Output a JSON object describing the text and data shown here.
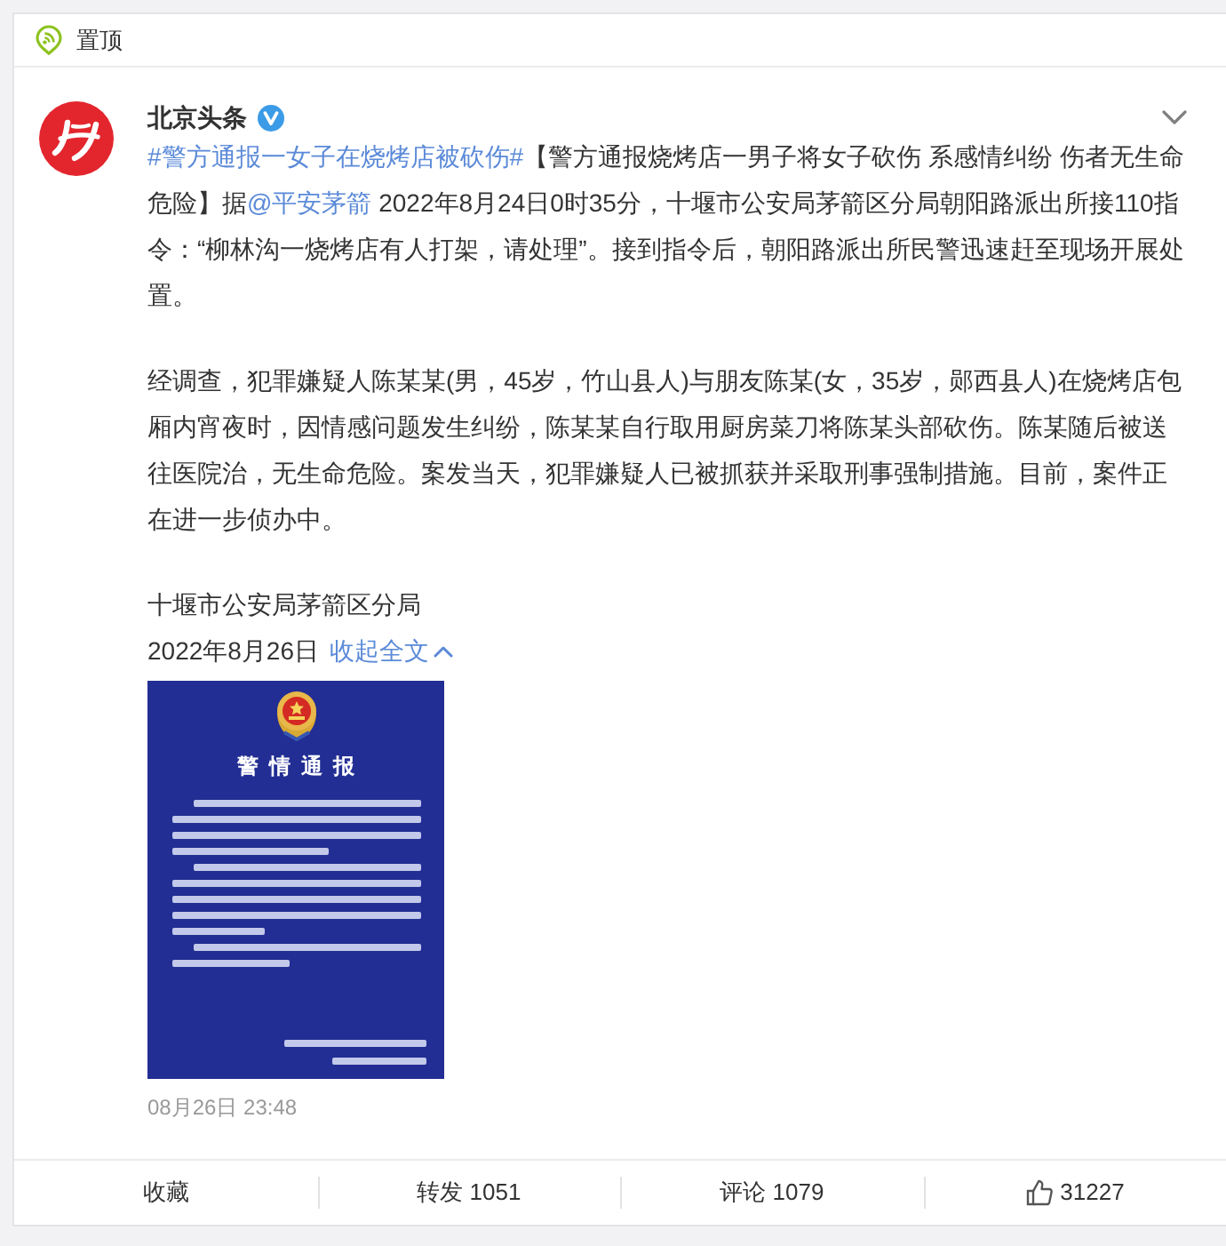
{
  "pinned_header": {
    "label": "置顶"
  },
  "post": {
    "author": {
      "name": "北京头条",
      "verified": true
    },
    "paragraphs": [
      {
        "segments": [
          {
            "kind": "hashtag",
            "text": "#警方通报一女子在烧烤店被砍伤#"
          },
          {
            "kind": "text",
            "text": "【警方通报烧烤店一男子将女子砍伤 系感情纠纷 伤者无生命危险】据"
          },
          {
            "kind": "mention",
            "text": "@平安茅箭"
          },
          {
            "kind": "text",
            "text": " 2022年8月24日0时35分，十堰市公安局茅箭区分局朝阳路派出所接110指令：“柳林沟一烧烤店有人打架，请处理”。接到指令后，朝阳路派出所民警迅速赶至现场开展处置。"
          }
        ]
      },
      {
        "segments": [
          {
            "kind": "text",
            "text": "经调查，犯罪嫌疑人陈某某(男，45岁，竹山县人)与朋友陈某(女，35岁，郧西县人)在烧烤店包厢内宵夜时，因情感问题发生纠纷，陈某某自行取用厨房菜刀将陈某头部砍伤。陈某随后被送往医院治，无生命危险。案发当天，犯罪嫌疑人已被抓获并采取刑事强制措施。目前，案件正在进一步侦办中。"
          }
        ]
      }
    ],
    "signature": {
      "organization": "十堰市公安局茅箭区分局",
      "date": "2022年8月26日",
      "collapse_link": "收起全文"
    },
    "image": {
      "title": "警情通报"
    },
    "timestamp": "08月26日 23:48"
  },
  "actions": [
    {
      "kind": "favorite",
      "label": "收藏"
    },
    {
      "kind": "repost",
      "label": "转发",
      "count": "1051"
    },
    {
      "kind": "comment",
      "label": "评论",
      "count": "1079"
    },
    {
      "kind": "like",
      "count": "31227"
    }
  ]
}
